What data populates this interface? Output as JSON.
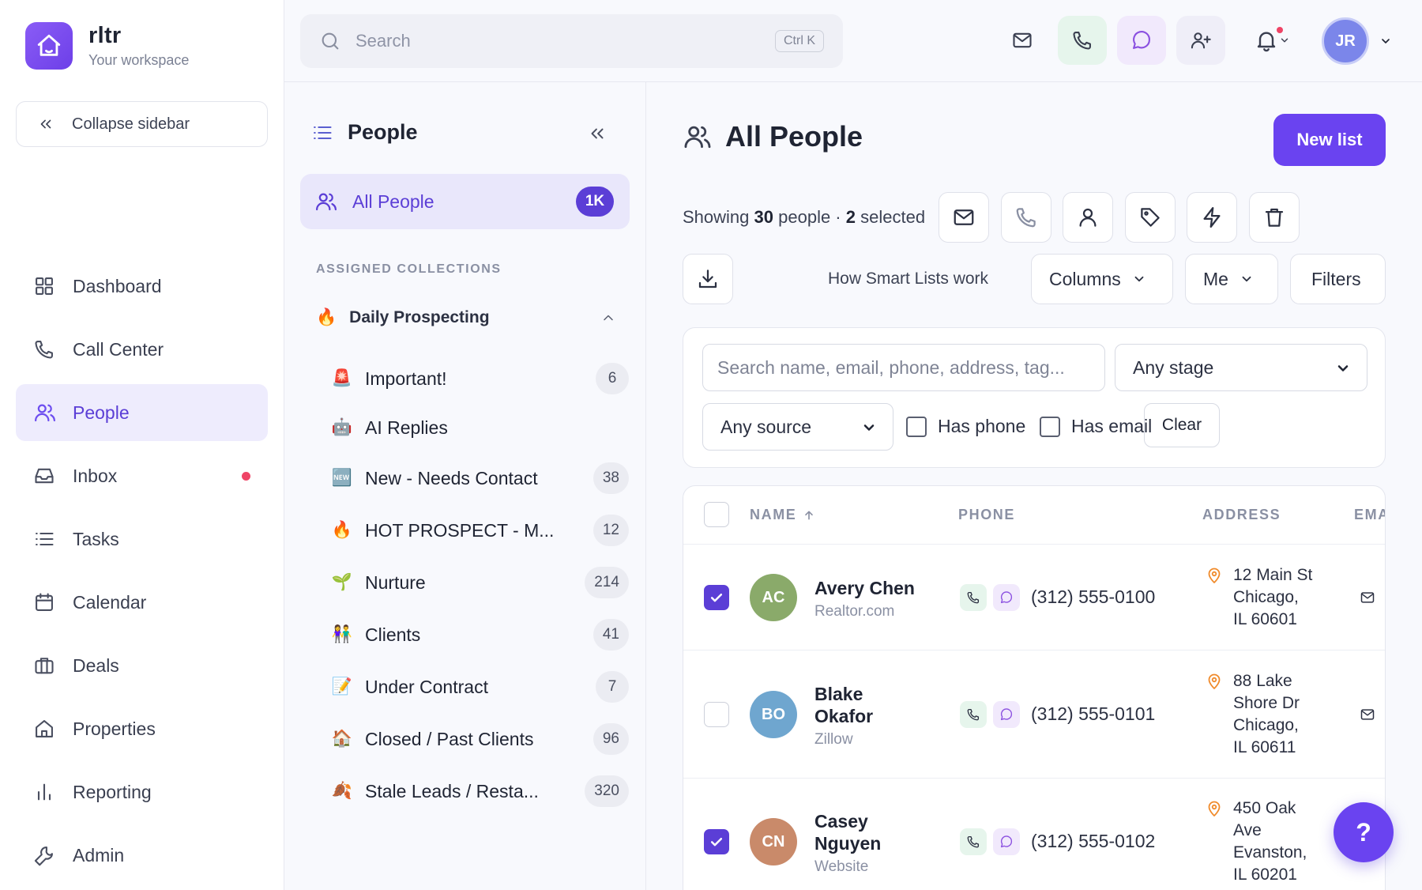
{
  "brand": {
    "name": "rltr",
    "subtitle": "Your workspace"
  },
  "sidebar": {
    "collapse_label": "Collapse sidebar",
    "items": [
      {
        "label": "Dashboard",
        "icon": "grid-icon"
      },
      {
        "label": "Call Center",
        "icon": "phone-icon"
      },
      {
        "label": "People",
        "icon": "users-icon",
        "active": true
      },
      {
        "label": "Inbox",
        "icon": "inbox-icon",
        "dot": true
      },
      {
        "label": "Tasks",
        "icon": "list-icon"
      },
      {
        "label": "Calendar",
        "icon": "calendar-icon"
      },
      {
        "label": "Deals",
        "icon": "briefcase-icon"
      },
      {
        "label": "Properties",
        "icon": "home-icon"
      },
      {
        "label": "Reporting",
        "icon": "bar-chart-icon"
      },
      {
        "label": "Admin",
        "icon": "wrench-icon"
      }
    ]
  },
  "topbar": {
    "search_placeholder": "Search",
    "shortcut": "Ctrl K",
    "user_initials": "JR"
  },
  "people_panel": {
    "title": "People",
    "all_people": {
      "label": "All People",
      "badge": "1K"
    },
    "section_label": "ASSIGNED COLLECTIONS",
    "group": {
      "emoji": "🔥",
      "label": "Daily Prospecting"
    },
    "collections": [
      {
        "emoji": "🚨",
        "label": "Important!",
        "count": "6"
      },
      {
        "emoji": "🤖",
        "label": "AI Replies",
        "count": ""
      },
      {
        "emoji": "🆕",
        "label": "New - Needs Contact",
        "count": "38"
      },
      {
        "emoji": "🔥",
        "label": "HOT PROSPECT - M...",
        "count": "12"
      },
      {
        "emoji": "🌱",
        "label": "Nurture",
        "count": "214"
      },
      {
        "emoji": "👫",
        "label": "Clients",
        "count": "41"
      },
      {
        "emoji": "📝",
        "label": "Under Contract",
        "count": "7"
      },
      {
        "emoji": "🏠",
        "label": "Closed / Past Clients",
        "count": "96"
      },
      {
        "emoji": "🍂",
        "label": "Stale Leads / Resta...",
        "count": "320"
      }
    ]
  },
  "main": {
    "title": "All People",
    "new_list_label": "New list",
    "showing": {
      "prefix": "Showing",
      "count": "30",
      "mid": "people ·",
      "selected": "2",
      "suffix": "selected"
    },
    "how_link": "How Smart Lists work",
    "columns_label": "Columns",
    "owner_label": "Me",
    "filters_label": "Filters",
    "filter_search_placeholder": "Search name, email, phone, address, tag...",
    "stage_select": "Any stage",
    "source_select": "Any source",
    "has_phone": "Has phone",
    "has_email": "Has email",
    "clear_label": "Clear",
    "columns": {
      "name": "NAME",
      "phone": "PHONE",
      "address": "ADDRESS",
      "email": "EMA"
    },
    "rows": [
      {
        "initials": "AC",
        "color": "#8aaa6a",
        "name": "Avery Chen",
        "source": "Realtor.com",
        "phone": "(312) 555-0100",
        "address": [
          "12 Main St",
          "Chicago,",
          "IL 60601"
        ],
        "checked": true
      },
      {
        "initials": "BO",
        "color": "#6fa6cf",
        "name": "Blake Okafor",
        "source": "Zillow",
        "phone": "(312) 555-0101",
        "address": [
          "88 Lake",
          "Shore Dr",
          "Chicago,",
          "IL 60611"
        ],
        "checked": false
      },
      {
        "initials": "CN",
        "color": "#c98a6a",
        "name": "Casey Nguyen",
        "source": "Website",
        "phone": "(312) 555-0102",
        "address": [
          "450 Oak",
          "Ave",
          "Evanston,",
          "IL 60201"
        ],
        "checked": true
      }
    ]
  },
  "help_label": "?",
  "colors": {
    "accent": "#6a43f0",
    "active_bg": "#eeecfd",
    "alert": "#ef4466"
  }
}
